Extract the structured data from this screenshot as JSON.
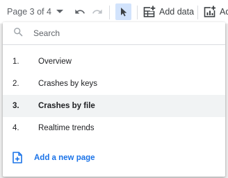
{
  "toolbar": {
    "page_indicator": "Page 3 of 4",
    "add_data_label": "Add data",
    "add_chart_label_partial": "Ad"
  },
  "page_menu": {
    "search": {
      "placeholder": "Search",
      "value": ""
    },
    "pages": [
      {
        "number": "1.",
        "label": "Overview",
        "active": false
      },
      {
        "number": "2.",
        "label": "Crashes by keys",
        "active": false
      },
      {
        "number": "3.",
        "label": "Crashes by file",
        "active": true
      },
      {
        "number": "4.",
        "label": "Realtime trends",
        "active": false
      }
    ],
    "add_page_label": "Add a new page"
  },
  "colors": {
    "accent": "#1a73e8",
    "selected_tool_bg": "#d2e3fc",
    "active_row_bg": "#f1f3f4"
  },
  "icons": [
    "chevron-down-icon",
    "undo-icon",
    "redo-icon",
    "cursor-icon",
    "add-data-icon",
    "add-chart-icon",
    "search-icon",
    "add-page-icon"
  ]
}
